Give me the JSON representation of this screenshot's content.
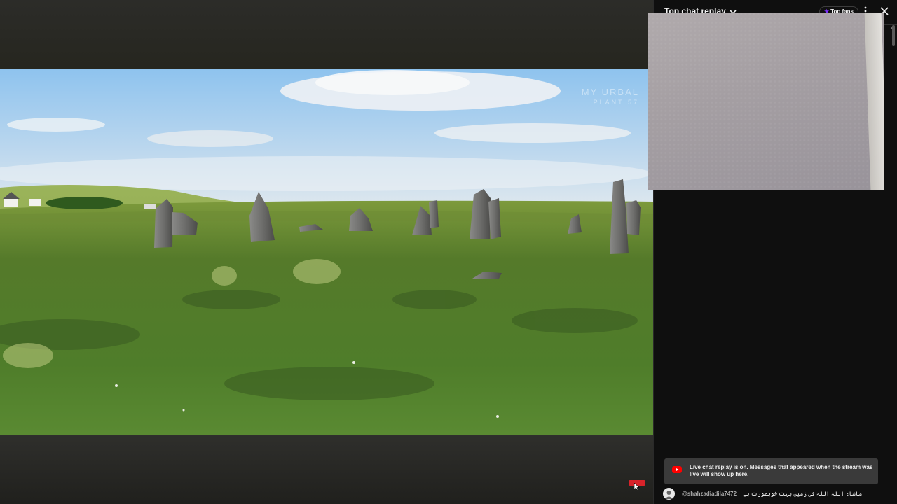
{
  "video": {
    "watermark_line1": "MY URBAL",
    "watermark_line2": "PLANT 57"
  },
  "chat": {
    "title": "Top chat replay",
    "top_fans_label": "Top fans",
    "banner_text": "Live chat replay is on. Messages that appeared when the stream was live will show up here.",
    "messages": [
      {
        "author": "@shahzadiadila7472",
        "text": "ماشاء اللہ اللہ کی زمین بہت خوبصورت ہے"
      }
    ]
  },
  "icons": {
    "dropdown": "chevron-down-icon",
    "top_fans": "star-icon",
    "more": "more-vert-icon",
    "close": "close-icon",
    "youtube": "youtube-icon"
  },
  "colors": {
    "chat_bg": "#0f0f0f",
    "banner_bg": "#3a3a3a",
    "youtube_red": "#ff0000",
    "top_fans_star": "#7b2ff7"
  }
}
